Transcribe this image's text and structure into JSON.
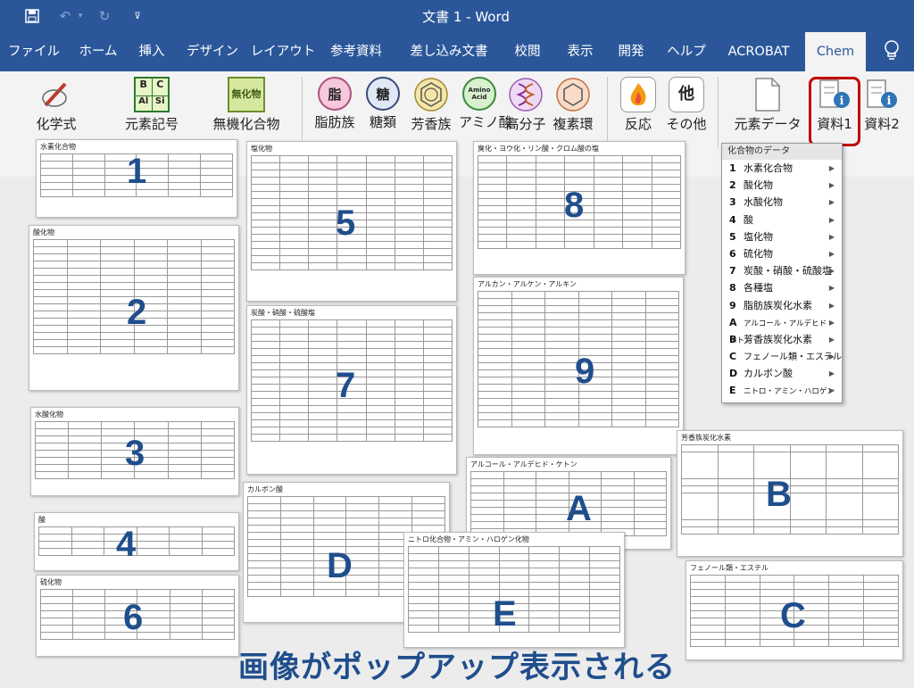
{
  "titlebar": {
    "title": "文書 1  -  Word",
    "save_icon": "save-icon",
    "undo_icon": "undo-icon",
    "redo_icon": "redo-icon",
    "customize_icon": "customize-qat-icon"
  },
  "tabs": [
    {
      "label": "ファイル"
    },
    {
      "label": "ホーム"
    },
    {
      "label": "挿入"
    },
    {
      "label": "デザイン"
    },
    {
      "label": "レイアウト"
    },
    {
      "label": "参考資料"
    },
    {
      "label": "差し込み文書"
    },
    {
      "label": "校閲"
    },
    {
      "label": "表示"
    },
    {
      "label": "開発"
    },
    {
      "label": "ヘルプ"
    },
    {
      "label": "ACROBAT"
    },
    {
      "label": "Chem"
    }
  ],
  "ribbon": {
    "chemical_formula": "化学式",
    "element_symbol": "元素記号",
    "inorganic": "無機化合物",
    "lipid": "脂肪族",
    "sugar": "糖類",
    "aromatic": "芳香族",
    "amino": "アミノ酸",
    "polymer": "高分子",
    "complex": "複素環",
    "reaction": "反応",
    "other": "その他",
    "element_data": "元素データ",
    "material1": "資料1",
    "material2": "資料2",
    "icon_labels": {
      "lipid": "脂",
      "sugar": "糖",
      "other": "他",
      "inorganic": "無化物",
      "amino": "Amino Acid",
      "bc_top": "B",
      "bc_top2": "C",
      "bc_bot": "Al",
      "bc_bot2": "Si"
    }
  },
  "menu": {
    "header": "化合物のデータ",
    "items": [
      {
        "key": "1",
        "label": "水素化合物"
      },
      {
        "key": "2",
        "label": "酸化物"
      },
      {
        "key": "3",
        "label": "水酸化物"
      },
      {
        "key": "4",
        "label": "酸"
      },
      {
        "key": "5",
        "label": "塩化物"
      },
      {
        "key": "6",
        "label": "硫化物"
      },
      {
        "key": "7",
        "label": "炭酸・硝酸・硫酸塩"
      },
      {
        "key": "8",
        "label": "各種塩"
      },
      {
        "key": "9",
        "label": "脂肪族炭化水素"
      },
      {
        "key": "A",
        "label": "アルコール・アルデヒド・ケトン"
      },
      {
        "key": "B",
        "label": "芳香族炭化水素"
      },
      {
        "key": "C",
        "label": "フェノール類・エステル"
      },
      {
        "key": "D",
        "label": "カルボン酸"
      },
      {
        "key": "E",
        "label": "ニトロ・アミン・ハロゲン"
      }
    ]
  },
  "sheets": [
    {
      "id": "1",
      "title": "水素化合物"
    },
    {
      "id": "2",
      "title": "酸化物"
    },
    {
      "id": "3",
      "title": "水酸化物"
    },
    {
      "id": "4",
      "title": "酸"
    },
    {
      "id": "6",
      "title": "硫化物"
    },
    {
      "id": "5",
      "title": "塩化物"
    },
    {
      "id": "7",
      "title": "炭酸・硝酸・硫酸塩"
    },
    {
      "id": "D",
      "title": "カルボン酸"
    },
    {
      "id": "8",
      "title": "臭化・ヨウ化・リン酸・クロム酸の塩"
    },
    {
      "id": "9",
      "title": "アルカン・アルケン・アルキン"
    },
    {
      "id": "A",
      "title": "アルコール・アルデヒド・ケトン"
    },
    {
      "id": "B",
      "title": "芳香族炭化水素"
    },
    {
      "id": "E",
      "title": "ニトロ化合物・アミン・ハロゲン化物"
    },
    {
      "id": "C",
      "title": "フェノール類・エステル"
    }
  ],
  "caption": "画像がポップアップ表示される",
  "colors": {
    "word_blue": "#2b579a",
    "number_blue": "#1f4e8c",
    "highlight_red": "#c00000"
  }
}
